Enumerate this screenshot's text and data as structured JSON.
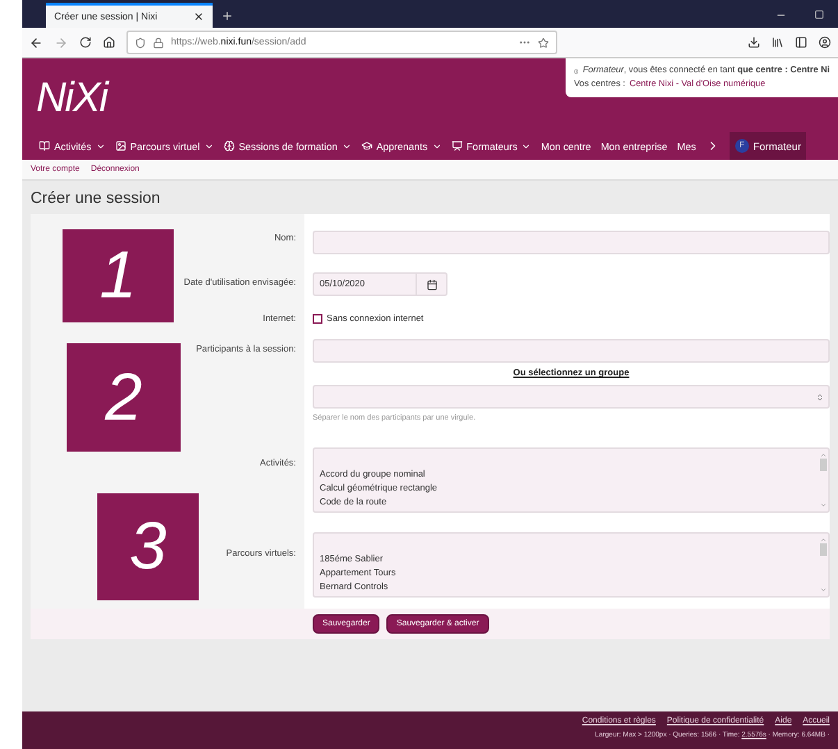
{
  "browser": {
    "tab_title": "Créer une session | Nixi",
    "url_prefix": "https://web.",
    "url_domain": "nixi.fun",
    "url_path": "/session/add"
  },
  "header": {
    "logo": "NiXi",
    "notice": "*Formateur*, vous êtes connecté en tant **que centre : Centre Ni**",
    "centres_label": "Vos centres : ",
    "centres_link": "Centre Nixi - Val d'Oise numérique"
  },
  "nav": [
    {
      "label": "Activités",
      "caret": true,
      "kind": "book"
    },
    {
      "label": "Parcours virtuel",
      "caret": true,
      "kind": "image"
    },
    {
      "label": "Sessions de formation",
      "caret": true,
      "kind": "brain"
    },
    {
      "label": "Apprenants",
      "caret": true,
      "kind": "cap"
    },
    {
      "label": "Formateurs",
      "caret": true,
      "kind": "board"
    },
    {
      "label": "Mon centre",
      "caret": false,
      "kind": "none"
    },
    {
      "label": "Mon entreprise",
      "caret": false,
      "kind": "none"
    },
    {
      "label": "Mes",
      "caret": false,
      "kind": "none"
    }
  ],
  "user": {
    "initial": "F",
    "label": "Formateur"
  },
  "sub_links": [
    "Votre compte",
    "Déconnexion"
  ],
  "page_title": "Créer une session",
  "form": {
    "name_label": "Nom:",
    "date_label": "Date d'utilisation envisagée:",
    "date_value": "05/10/2020",
    "internet_label": "Internet:",
    "offline_label": "Sans connexion internet",
    "offline_checked": false,
    "participants_label": "Participants à la session:",
    "group_link": "Ou sélectionnez un groupe",
    "participants_help": "Séparer le nom des participants par une virgule.",
    "activities_label": "Activités:",
    "activities": [
      "Accord du groupe nominal",
      "Calcul géométrique rectangle",
      "Code de la route"
    ],
    "courses_label": "Parcours virtuels:",
    "courses": [
      "185éme Sablier",
      "Appartement Tours",
      "Bernard Controls"
    ]
  },
  "buttons": [
    "Sauvegarder",
    "Sauvegarder & activer"
  ],
  "markers": [
    "1",
    "2",
    "3"
  ],
  "footer": {
    "links": [
      "Conditions et règles",
      "Politique de confidentialité",
      "Aide",
      "Accueil"
    ],
    "stats_prefix": "Largeur: Max > 1200px · Queries: 1566 · Time: ",
    "stats_time": "2.5576s",
    "stats_suffix": " · Memory: 6.64MB ·"
  }
}
